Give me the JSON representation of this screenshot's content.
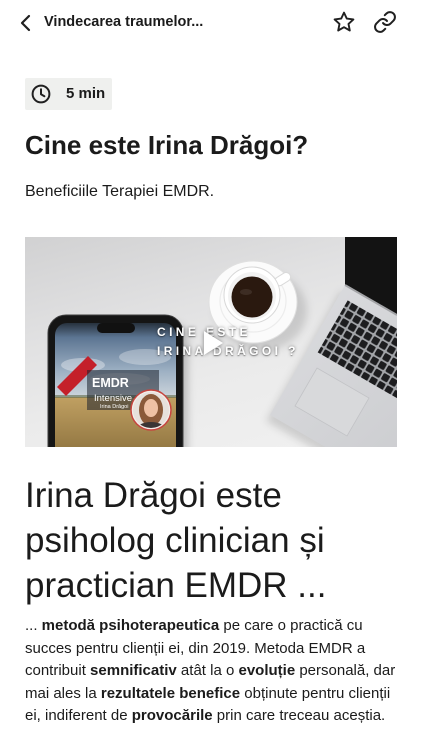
{
  "header": {
    "back_icon": "chevron-left-icon",
    "title": "Vindecarea traumelor...",
    "favorite_icon": "star-outline-icon",
    "link_icon": "link-icon"
  },
  "reading_time": {
    "icon": "clock-icon",
    "label": "5 min"
  },
  "article": {
    "title": "Cine este Irina Drăgoi?",
    "subtitle": "Beneficiile Terapiei EMDR.",
    "video": {
      "play_icon": "play-icon",
      "overlay_line1": "CINE ESTE",
      "overlay_line2": "IRINA DRĂGOI ?",
      "phone_screen": {
        "title": "EMDR",
        "subtitle": "Intensive",
        "author": "Irina Drăgoi"
      }
    },
    "heading": "Irina Drăgoi este psiholog clinician și practician EMDR ...",
    "paragraph": [
      {
        "text": "... ",
        "bold": false
      },
      {
        "text": "metodă psihoterapeutica",
        "bold": true
      },
      {
        "text": " pe care o practică cu succes pentru clienții ei, din 2019. Metoda EMDR a contribuit ",
        "bold": false
      },
      {
        "text": "semnificativ",
        "bold": true
      },
      {
        "text": " atât la o ",
        "bold": false
      },
      {
        "text": "evoluție",
        "bold": true
      },
      {
        "text": " personală, dar mai ales la ",
        "bold": false
      },
      {
        "text": "rezultatele benefice",
        "bold": true
      },
      {
        "text": " obținute pentru clienții ei, indiferent de ",
        "bold": false
      },
      {
        "text": "provocările",
        "bold": true
      },
      {
        "text": " prin care treceau aceștia.",
        "bold": false
      }
    ]
  },
  "colors": {
    "page_background": "#ffffff",
    "text": "#1b1b1b",
    "icon": "#202020",
    "badge_background": "#eff0ee"
  }
}
